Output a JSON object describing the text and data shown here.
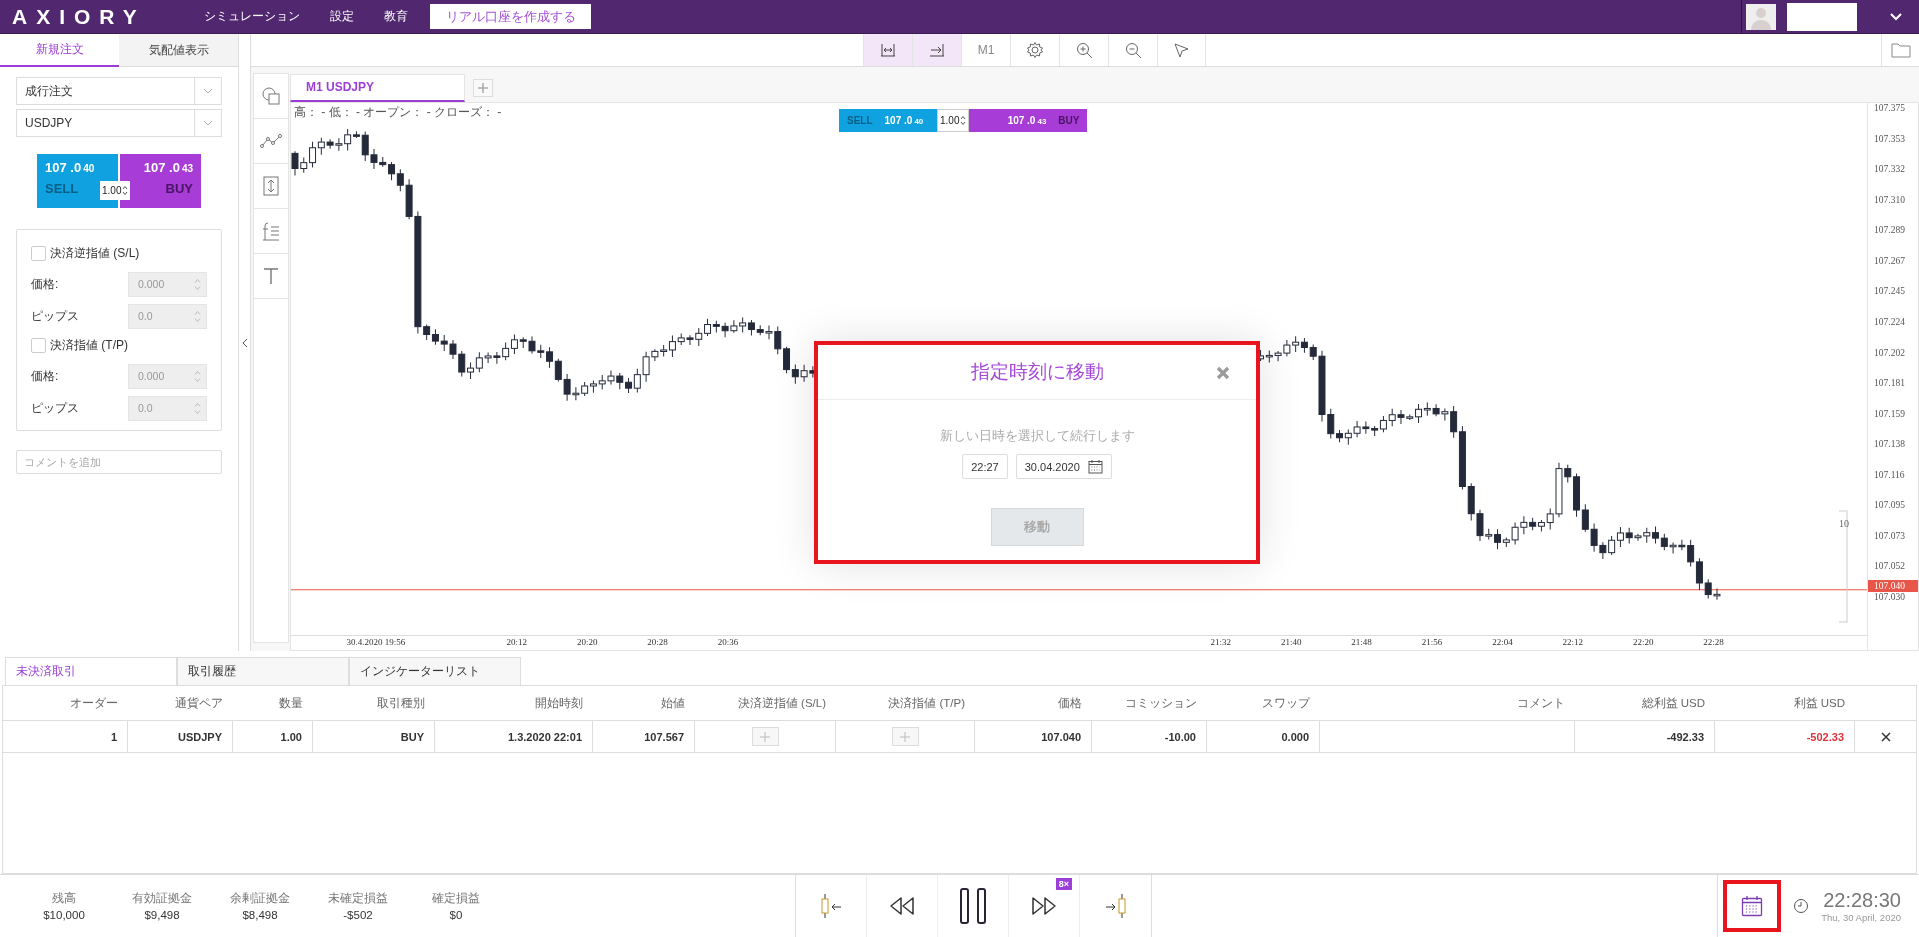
{
  "header": {
    "logo": "AXIORY",
    "nav": [
      {
        "label": "シミュレーション"
      },
      {
        "label": "設定"
      },
      {
        "label": "教育"
      }
    ],
    "cta": "リアル口座を作成する"
  },
  "order_panel": {
    "tabs": [
      {
        "label": "新規注文",
        "selected": true
      },
      {
        "label": "気配値表示",
        "selected": false
      }
    ],
    "order_type": "成行注文",
    "symbol": "USDJPY",
    "sell": {
      "price": "107 .0",
      "pips": "40",
      "label": "SELL"
    },
    "buy": {
      "price": "107 .0",
      "pips": "43",
      "label": "BUY"
    },
    "lot": "1.00",
    "stop_loss": {
      "label": "決済逆指値 (S/L)",
      "checked": false,
      "price_label": "価格:",
      "price": "0.000",
      "pips_label": "ピップス",
      "pips": "0.0"
    },
    "take_profit": {
      "label": "決済指値 (T/P)",
      "checked": false,
      "price_label": "価格:",
      "price": "0.000",
      "pips_label": "ピップス",
      "pips": "0.0"
    },
    "comment_placeholder": "コメントを追加"
  },
  "chart_toolbar": {
    "tools": [
      {
        "kind": "fit",
        "active": true
      },
      {
        "kind": "scroll-end",
        "active": true
      },
      {
        "kind": "timeframe",
        "label": "M1",
        "active": false
      },
      {
        "kind": "settings",
        "active": false
      },
      {
        "kind": "zoom-in",
        "active": false
      },
      {
        "kind": "zoom-out",
        "active": false
      },
      {
        "kind": "cursor",
        "active": false
      }
    ]
  },
  "chart": {
    "tab": "M1 USDJPY",
    "drawing_tools": [
      {
        "kind": "shapes"
      },
      {
        "kind": "line"
      },
      {
        "kind": "measure"
      },
      {
        "kind": "fibonacci"
      },
      {
        "kind": "text"
      }
    ],
    "ohlc": "高： - 低： - オープン： - クローズ： -",
    "quick_trade": {
      "sell_label": "SELL",
      "sell_price": "107 .0",
      "sell_pips": "40",
      "lot": "1.00",
      "buy_price": "107 .0",
      "buy_pips": "43",
      "buy_label": "BUY"
    },
    "price_ticks": [
      "107.375",
      "107.353",
      "107.332",
      "107.310",
      "107.289",
      "107.267",
      "107.245",
      "107.224",
      "107.202",
      "107.181",
      "107.159",
      "107.138",
      "107.116",
      "107.095",
      "107.073",
      "107.052",
      "107.030"
    ],
    "current_price": "107.040",
    "volume_label": "10",
    "time_labels": [
      "30.4.2020 19:56",
      "20:12",
      "20:20",
      "20:28",
      "20:36",
      "21:32",
      "21:40",
      "21:48",
      "21:56",
      "22:04",
      "22:12",
      "22:20",
      "22:28"
    ]
  },
  "modal": {
    "title": "指定時刻に移動",
    "message": "新しい日時を選択して続行します",
    "time": "22:27",
    "date": "30.04.2020",
    "button": "移動",
    "highlighted": true
  },
  "positions": {
    "tabs": [
      {
        "label": "未決済取引",
        "selected": true
      },
      {
        "label": "取引履歴",
        "selected": false
      },
      {
        "label": "インジケーターリスト",
        "selected": false
      }
    ],
    "columns": [
      "オーダー",
      "通貨ペア",
      "数量",
      "取引種別",
      "開始時刻",
      "始値",
      "決済逆指値 (S/L)",
      "決済指値 (T/P)",
      "価格",
      "コミッション",
      "スワップ",
      "コメント",
      "総利益 USD",
      "利益 USD"
    ],
    "rows": [
      {
        "order": "1",
        "pair": "USDJPY",
        "volume": "1.00",
        "type": "BUY",
        "open_time": "1.3.2020 22:01",
        "open_price": "107.567",
        "price": "107.040",
        "commission": "-10.00",
        "swap": "0.000",
        "gross": "-492.33",
        "profit": "-502.33",
        "profit_negative": true
      }
    ]
  },
  "account": [
    {
      "label": "残高",
      "value": "$10,000"
    },
    {
      "label": "有効証拠金",
      "value": "$9,498"
    },
    {
      "label": "余剰証拠金",
      "value": "$8,498"
    },
    {
      "label": "未確定損益",
      "value": "-$502"
    },
    {
      "label": "確定損益",
      "value": "$0"
    }
  ],
  "playback": {
    "speed": "8×",
    "calendar_highlighted": true,
    "time": "22:28:30",
    "date": "Thu, 30 April, 2020"
  }
}
